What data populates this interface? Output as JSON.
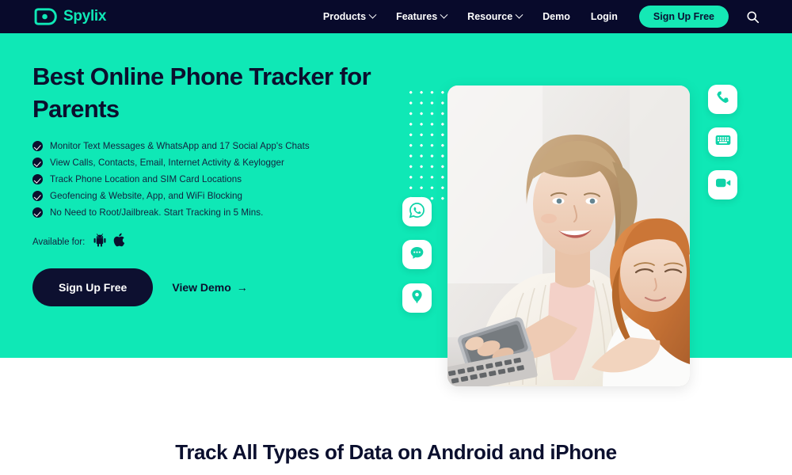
{
  "brand": {
    "name": "Spylix",
    "logo_icon": "eye-shield-icon",
    "accent_color": "#0fe8b6",
    "dark_color": "#080a2b"
  },
  "navbar": {
    "items": [
      {
        "label": "Products",
        "has_dropdown": true
      },
      {
        "label": "Features",
        "has_dropdown": true
      },
      {
        "label": "Resource",
        "has_dropdown": true
      },
      {
        "label": "Demo",
        "has_dropdown": false
      },
      {
        "label": "Login",
        "has_dropdown": false
      }
    ],
    "signup_label": "Sign Up Free",
    "search_icon": "search-icon"
  },
  "hero": {
    "title": "Best Online Phone Tracker for Parents",
    "bullets": [
      "Monitor Text Messages & WhatsApp and 17 Social App's Chats",
      "View Calls, Contacts, Email, Internet Activity & Keylogger",
      "Track Phone Location and SIM Card Locations",
      "Geofencing & Website, App, and WiFi Blocking",
      "No Need to Root/Jailbreak. Start Tracking in 5 Mins."
    ],
    "available_label": "Available for:",
    "platforms": [
      {
        "name": "android-icon"
      },
      {
        "name": "apple-icon"
      }
    ],
    "primary_cta": "Sign Up Free",
    "secondary_cta": "View Demo",
    "secondary_cta_arrow": "→",
    "image_alt": "mother-and-daughter-using-phone",
    "left_badges": [
      {
        "icon": "whatsapp-icon"
      },
      {
        "icon": "chat-bubble-icon"
      },
      {
        "icon": "location-pin-icon"
      }
    ],
    "right_badges": [
      {
        "icon": "phone-call-icon"
      },
      {
        "icon": "keyboard-icon"
      },
      {
        "icon": "video-camera-icon"
      }
    ]
  },
  "section_features": {
    "title": "Track All Types of Data on Android and iPhone"
  }
}
